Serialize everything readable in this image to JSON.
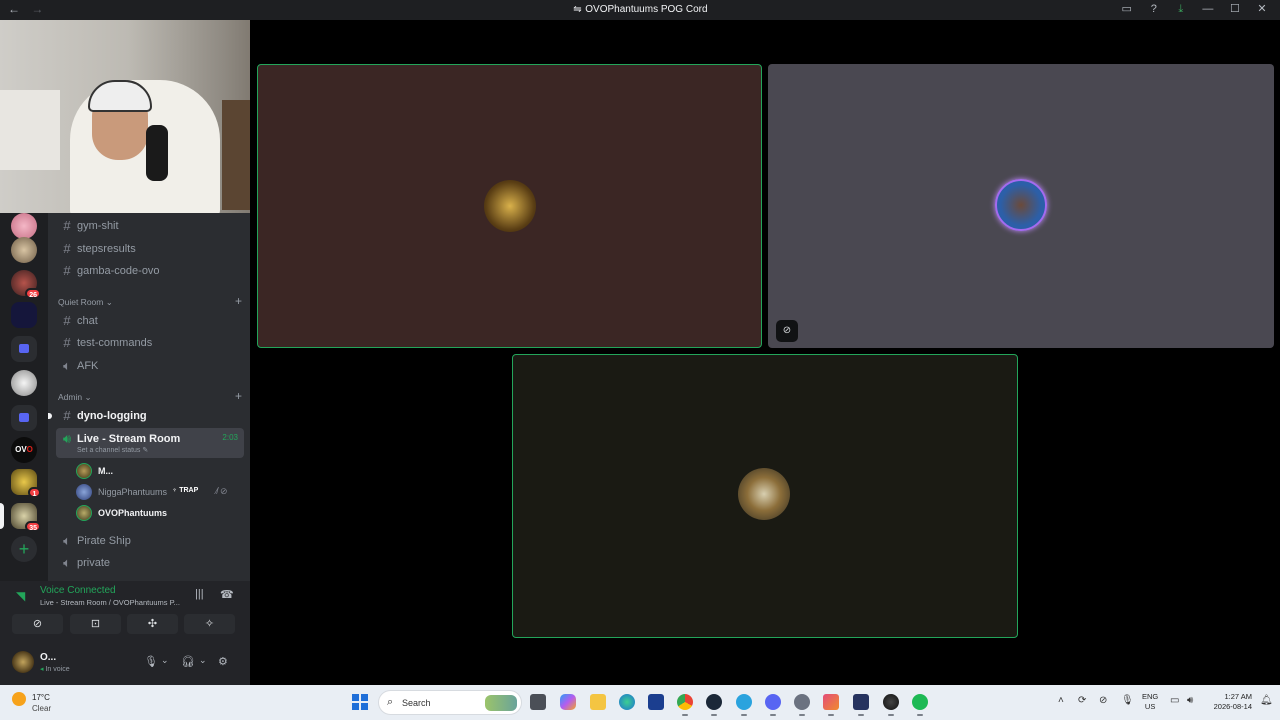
{
  "window": {
    "title": "OVOPhantuums POG Cord",
    "back": "←",
    "forward": "→"
  },
  "channels": {
    "items": [
      {
        "name": "gym-shit",
        "type": "text"
      },
      {
        "name": "stepsresults",
        "type": "text"
      },
      {
        "name": "gamba-code-ovo",
        "type": "text"
      }
    ],
    "quiet_room": {
      "label": "Quiet Room",
      "items": [
        {
          "name": "chat",
          "type": "text"
        },
        {
          "name": "test-commands",
          "type": "text"
        },
        {
          "name": "AFK",
          "type": "voice"
        }
      ]
    },
    "admin": {
      "label": "Admin",
      "dyno": "dyno-logging",
      "live": {
        "name": "Live - Stream Room",
        "time": "2:03",
        "status_prompt": "Set a channel status"
      },
      "members": [
        {
          "name": "M..."
        },
        {
          "name": "NiggaPhantuums",
          "tag": "TRAP"
        },
        {
          "name": "OVOPhantuums"
        }
      ],
      "after": [
        {
          "name": "Pirate Ship",
          "type": "voice"
        },
        {
          "name": "private",
          "type": "voice"
        }
      ]
    }
  },
  "guild_badges": {
    "g3": "26",
    "g7": "1",
    "g8": "35",
    "g8_top": "4"
  },
  "voice": {
    "status": "Voice Connected",
    "location": "Live - Stream Room / OVOPhantuums P..."
  },
  "user": {
    "name": "O...",
    "status": "In voice"
  },
  "taskbar": {
    "temperature": "17°C",
    "condition": "Clear",
    "search_placeholder": "Search",
    "lang_1": "ENG",
    "lang_2": "US",
    "time": "1:27 AM",
    "date": "2026-08-14"
  },
  "colors": {
    "speaking_border": "#23a55a",
    "tile_1": "#3b2624",
    "tile_2": "#4a4851",
    "tile_3": "#1a1a13"
  }
}
